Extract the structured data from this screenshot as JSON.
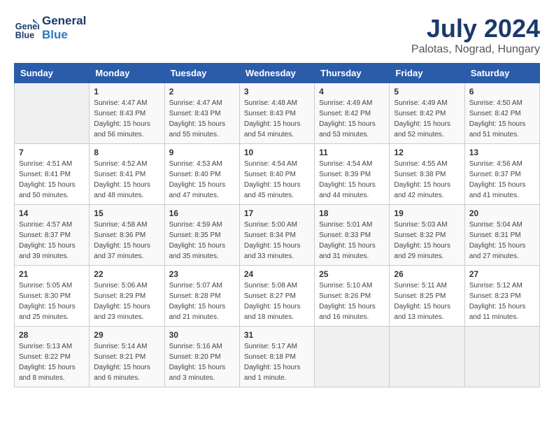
{
  "logo": {
    "line1": "General",
    "line2": "Blue"
  },
  "title": "July 2024",
  "location": "Palotas, Nograd, Hungary",
  "days_header": [
    "Sunday",
    "Monday",
    "Tuesday",
    "Wednesday",
    "Thursday",
    "Friday",
    "Saturday"
  ],
  "weeks": [
    [
      {
        "num": "",
        "sunrise": "",
        "sunset": "",
        "daylight": ""
      },
      {
        "num": "1",
        "sunrise": "Sunrise: 4:47 AM",
        "sunset": "Sunset: 8:43 PM",
        "daylight": "Daylight: 15 hours and 56 minutes."
      },
      {
        "num": "2",
        "sunrise": "Sunrise: 4:47 AM",
        "sunset": "Sunset: 8:43 PM",
        "daylight": "Daylight: 15 hours and 55 minutes."
      },
      {
        "num": "3",
        "sunrise": "Sunrise: 4:48 AM",
        "sunset": "Sunset: 8:43 PM",
        "daylight": "Daylight: 15 hours and 54 minutes."
      },
      {
        "num": "4",
        "sunrise": "Sunrise: 4:49 AM",
        "sunset": "Sunset: 8:42 PM",
        "daylight": "Daylight: 15 hours and 53 minutes."
      },
      {
        "num": "5",
        "sunrise": "Sunrise: 4:49 AM",
        "sunset": "Sunset: 8:42 PM",
        "daylight": "Daylight: 15 hours and 52 minutes."
      },
      {
        "num": "6",
        "sunrise": "Sunrise: 4:50 AM",
        "sunset": "Sunset: 8:42 PM",
        "daylight": "Daylight: 15 hours and 51 minutes."
      }
    ],
    [
      {
        "num": "7",
        "sunrise": "Sunrise: 4:51 AM",
        "sunset": "Sunset: 8:41 PM",
        "daylight": "Daylight: 15 hours and 50 minutes."
      },
      {
        "num": "8",
        "sunrise": "Sunrise: 4:52 AM",
        "sunset": "Sunset: 8:41 PM",
        "daylight": "Daylight: 15 hours and 48 minutes."
      },
      {
        "num": "9",
        "sunrise": "Sunrise: 4:53 AM",
        "sunset": "Sunset: 8:40 PM",
        "daylight": "Daylight: 15 hours and 47 minutes."
      },
      {
        "num": "10",
        "sunrise": "Sunrise: 4:54 AM",
        "sunset": "Sunset: 8:40 PM",
        "daylight": "Daylight: 15 hours and 45 minutes."
      },
      {
        "num": "11",
        "sunrise": "Sunrise: 4:54 AM",
        "sunset": "Sunset: 8:39 PM",
        "daylight": "Daylight: 15 hours and 44 minutes."
      },
      {
        "num": "12",
        "sunrise": "Sunrise: 4:55 AM",
        "sunset": "Sunset: 8:38 PM",
        "daylight": "Daylight: 15 hours and 42 minutes."
      },
      {
        "num": "13",
        "sunrise": "Sunrise: 4:56 AM",
        "sunset": "Sunset: 8:37 PM",
        "daylight": "Daylight: 15 hours and 41 minutes."
      }
    ],
    [
      {
        "num": "14",
        "sunrise": "Sunrise: 4:57 AM",
        "sunset": "Sunset: 8:37 PM",
        "daylight": "Daylight: 15 hours and 39 minutes."
      },
      {
        "num": "15",
        "sunrise": "Sunrise: 4:58 AM",
        "sunset": "Sunset: 8:36 PM",
        "daylight": "Daylight: 15 hours and 37 minutes."
      },
      {
        "num": "16",
        "sunrise": "Sunrise: 4:59 AM",
        "sunset": "Sunset: 8:35 PM",
        "daylight": "Daylight: 15 hours and 35 minutes."
      },
      {
        "num": "17",
        "sunrise": "Sunrise: 5:00 AM",
        "sunset": "Sunset: 8:34 PM",
        "daylight": "Daylight: 15 hours and 33 minutes."
      },
      {
        "num": "18",
        "sunrise": "Sunrise: 5:01 AM",
        "sunset": "Sunset: 8:33 PM",
        "daylight": "Daylight: 15 hours and 31 minutes."
      },
      {
        "num": "19",
        "sunrise": "Sunrise: 5:03 AM",
        "sunset": "Sunset: 8:32 PM",
        "daylight": "Daylight: 15 hours and 29 minutes."
      },
      {
        "num": "20",
        "sunrise": "Sunrise: 5:04 AM",
        "sunset": "Sunset: 8:31 PM",
        "daylight": "Daylight: 15 hours and 27 minutes."
      }
    ],
    [
      {
        "num": "21",
        "sunrise": "Sunrise: 5:05 AM",
        "sunset": "Sunset: 8:30 PM",
        "daylight": "Daylight: 15 hours and 25 minutes."
      },
      {
        "num": "22",
        "sunrise": "Sunrise: 5:06 AM",
        "sunset": "Sunset: 8:29 PM",
        "daylight": "Daylight: 15 hours and 23 minutes."
      },
      {
        "num": "23",
        "sunrise": "Sunrise: 5:07 AM",
        "sunset": "Sunset: 8:28 PM",
        "daylight": "Daylight: 15 hours and 21 minutes."
      },
      {
        "num": "24",
        "sunrise": "Sunrise: 5:08 AM",
        "sunset": "Sunset: 8:27 PM",
        "daylight": "Daylight: 15 hours and 18 minutes."
      },
      {
        "num": "25",
        "sunrise": "Sunrise: 5:10 AM",
        "sunset": "Sunset: 8:26 PM",
        "daylight": "Daylight: 15 hours and 16 minutes."
      },
      {
        "num": "26",
        "sunrise": "Sunrise: 5:11 AM",
        "sunset": "Sunset: 8:25 PM",
        "daylight": "Daylight: 15 hours and 13 minutes."
      },
      {
        "num": "27",
        "sunrise": "Sunrise: 5:12 AM",
        "sunset": "Sunset: 8:23 PM",
        "daylight": "Daylight: 15 hours and 11 minutes."
      }
    ],
    [
      {
        "num": "28",
        "sunrise": "Sunrise: 5:13 AM",
        "sunset": "Sunset: 8:22 PM",
        "daylight": "Daylight: 15 hours and 8 minutes."
      },
      {
        "num": "29",
        "sunrise": "Sunrise: 5:14 AM",
        "sunset": "Sunset: 8:21 PM",
        "daylight": "Daylight: 15 hours and 6 minutes."
      },
      {
        "num": "30",
        "sunrise": "Sunrise: 5:16 AM",
        "sunset": "Sunset: 8:20 PM",
        "daylight": "Daylight: 15 hours and 3 minutes."
      },
      {
        "num": "31",
        "sunrise": "Sunrise: 5:17 AM",
        "sunset": "Sunset: 8:18 PM",
        "daylight": "Daylight: 15 hours and 1 minute."
      },
      {
        "num": "",
        "sunrise": "",
        "sunset": "",
        "daylight": ""
      },
      {
        "num": "",
        "sunrise": "",
        "sunset": "",
        "daylight": ""
      },
      {
        "num": "",
        "sunrise": "",
        "sunset": "",
        "daylight": ""
      }
    ]
  ]
}
